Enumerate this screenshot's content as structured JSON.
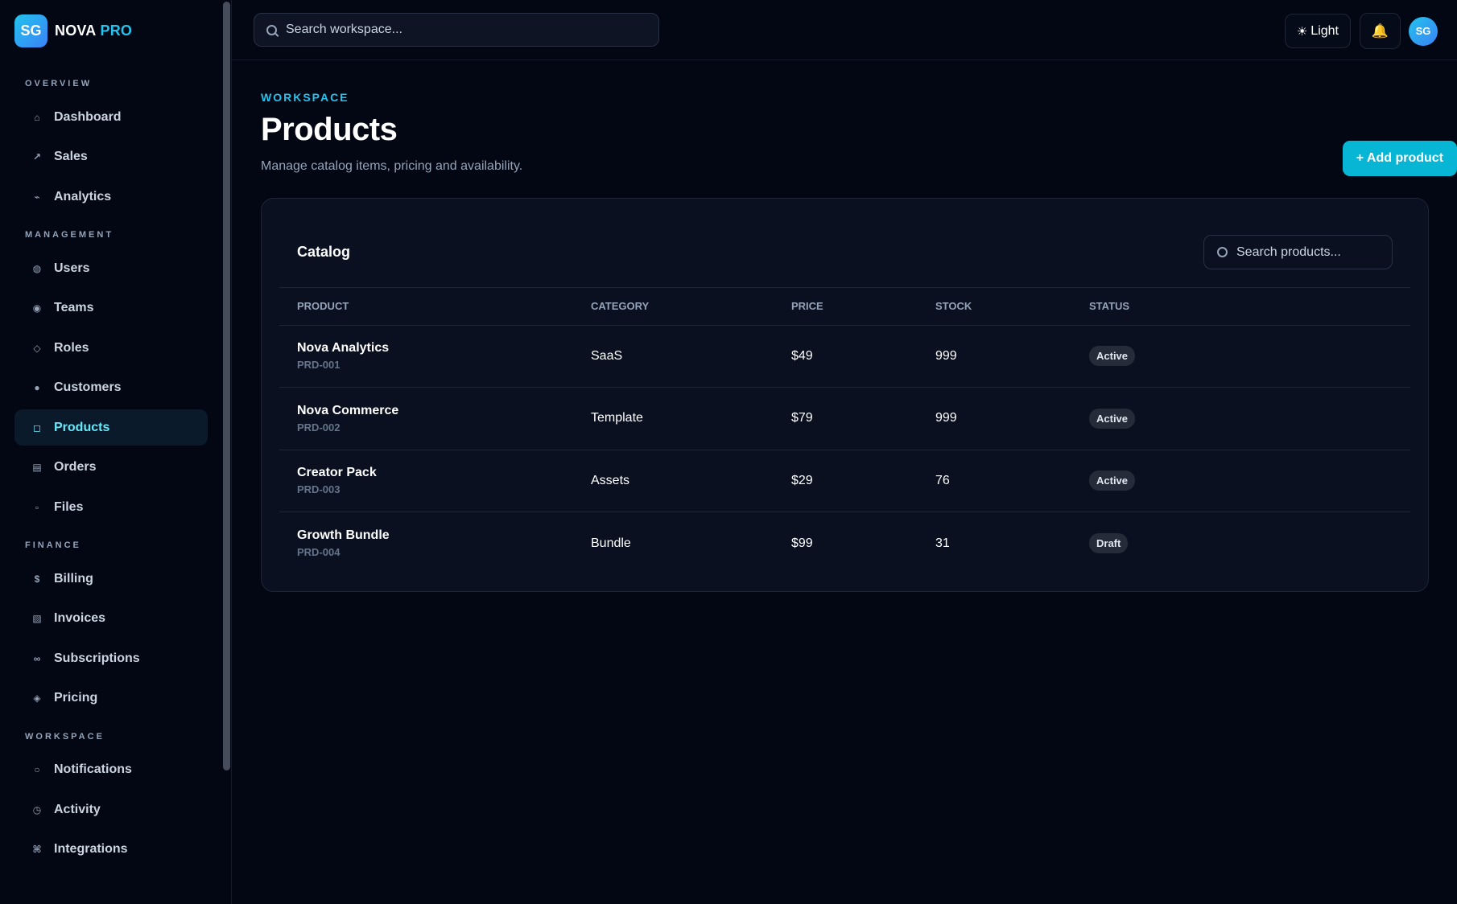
{
  "brand": {
    "logo": "SG",
    "name": "NOVA",
    "suffix": "PRO"
  },
  "sidebar": {
    "sections": [
      {
        "title": "OVERVIEW",
        "items": [
          {
            "label": "Dashboard",
            "icon": "⌂",
            "icon_name": "home-icon"
          },
          {
            "label": "Sales",
            "icon": "↗",
            "icon_name": "trend-up-icon"
          },
          {
            "label": "Analytics",
            "icon": "⌁",
            "icon_name": "analytics-icon"
          }
        ]
      },
      {
        "title": "MANAGEMENT",
        "items": [
          {
            "label": "Users",
            "icon": "◍",
            "icon_name": "users-icon"
          },
          {
            "label": "Teams",
            "icon": "◉",
            "icon_name": "teams-icon"
          },
          {
            "label": "Roles",
            "icon": "◇",
            "icon_name": "roles-icon"
          },
          {
            "label": "Customers",
            "icon": "●",
            "icon_name": "customers-icon"
          },
          {
            "label": "Products",
            "icon": "◻",
            "icon_name": "products-icon",
            "active": true
          },
          {
            "label": "Orders",
            "icon": "▤",
            "icon_name": "orders-icon"
          },
          {
            "label": "Files",
            "icon": "▫",
            "icon_name": "files-icon"
          }
        ]
      },
      {
        "title": "FINANCE",
        "items": [
          {
            "label": "Billing",
            "icon": "$",
            "icon_name": "billing-icon"
          },
          {
            "label": "Invoices",
            "icon": "▧",
            "icon_name": "invoices-icon"
          },
          {
            "label": "Subscriptions",
            "icon": "∞",
            "icon_name": "subscriptions-icon"
          },
          {
            "label": "Pricing",
            "icon": "◈",
            "icon_name": "pricing-icon"
          }
        ]
      },
      {
        "title": "WORKSPACE",
        "items": [
          {
            "label": "Notifications",
            "icon": "○",
            "icon_name": "notifications-icon"
          },
          {
            "label": "Activity",
            "icon": "◷",
            "icon_name": "activity-icon"
          },
          {
            "label": "Integrations",
            "icon": "⌘",
            "icon_name": "integrations-icon"
          }
        ]
      }
    ]
  },
  "topbar": {
    "search_placeholder": "Search workspace...",
    "theme_icon": "☀",
    "theme_label": "Light",
    "bell_icon": "🔔",
    "avatar": "SG"
  },
  "page": {
    "eyebrow": "WORKSPACE",
    "title": "Products",
    "subtitle": "Manage catalog items, pricing and availability.",
    "add_button": "+ Add product"
  },
  "catalog": {
    "title": "Catalog",
    "search_placeholder": "Search products...",
    "columns": [
      "PRODUCT",
      "CATEGORY",
      "PRICE",
      "STOCK",
      "STATUS"
    ],
    "rows": [
      {
        "name": "Nova Analytics",
        "sku": "PRD-001",
        "category": "SaaS",
        "price": "$49",
        "stock": "999",
        "status": "Active"
      },
      {
        "name": "Nova Commerce",
        "sku": "PRD-002",
        "category": "Template",
        "price": "$79",
        "stock": "999",
        "status": "Active"
      },
      {
        "name": "Creator Pack",
        "sku": "PRD-003",
        "category": "Assets",
        "price": "$29",
        "stock": "76",
        "status": "Active"
      },
      {
        "name": "Growth Bundle",
        "sku": "PRD-004",
        "category": "Bundle",
        "price": "$99",
        "stock": "31",
        "status": "Draft"
      }
    ]
  },
  "colors": {
    "accent": "#22c3ee",
    "button": "#06b6d4",
    "background": "#030713",
    "card": "#0a1020"
  }
}
